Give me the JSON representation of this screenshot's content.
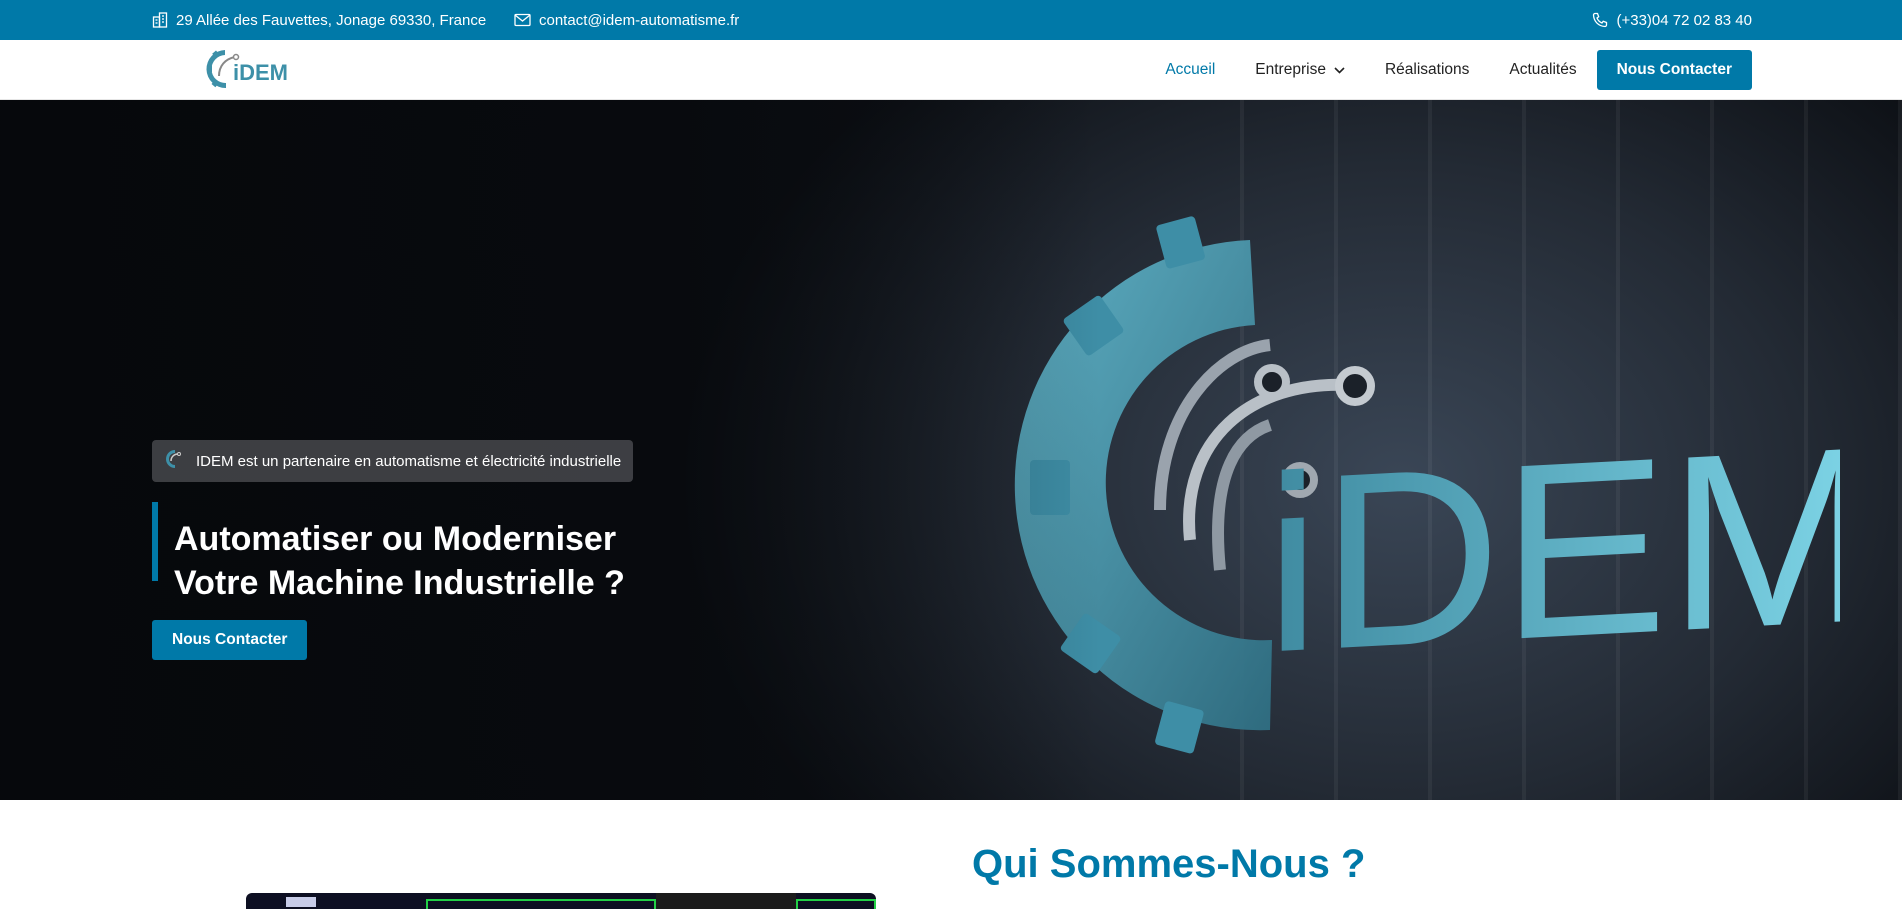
{
  "topbar": {
    "address": "29 Allée des Fauvettes, Jonage 69330, France",
    "email": "contact@idem-automatisme.fr",
    "phone": "(+33)04 72 02 83 40",
    "icons": [
      "building-icon",
      "mail-icon",
      "phone-icon"
    ]
  },
  "nav": {
    "logo_text": "iDEM",
    "items": [
      {
        "label": "Accueil",
        "active": true
      },
      {
        "label": "Entreprise",
        "has_dropdown": true
      },
      {
        "label": "Réalisations"
      },
      {
        "label": "Actualités"
      }
    ],
    "cta": "Nous Contacter"
  },
  "hero": {
    "badge": "IDEM est un partenaire en automatisme et électricité industrielle",
    "title_line1": "Automatiser ou Moderniser",
    "title_line2": "Votre Machine Industrielle ?",
    "button": "Nous Contacter",
    "logo_text": "iDEM"
  },
  "about": {
    "title": "Qui Sommes-Nous ?"
  },
  "colors": {
    "brand": "#0079a8",
    "hero_dark": "#0b0e13",
    "logo_teal": "#3d90a8"
  }
}
